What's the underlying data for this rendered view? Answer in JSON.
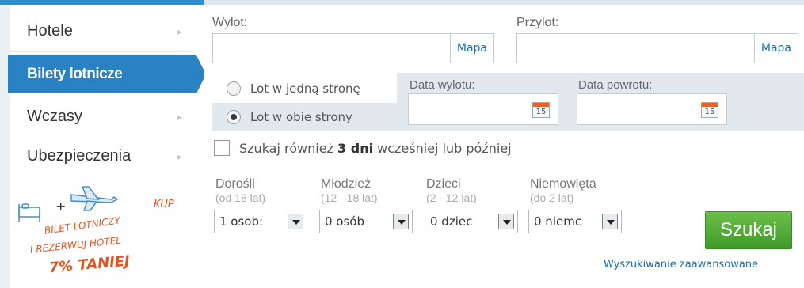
{
  "nav": {
    "items": [
      {
        "label": "Hotele"
      },
      {
        "label": "Bilety lotnicze"
      },
      {
        "label": "Wczasy"
      },
      {
        "label": "Ubezpieczenia"
      }
    ]
  },
  "promo": {
    "line1": "+",
    "line2": "KUP",
    "line3": "BILET LOTNICZY",
    "line4": "I REZERWUJ HOTEL",
    "line5": "7% TANIEJ"
  },
  "form": {
    "departure_label": "Wylot:",
    "arrival_label": "Przylot:",
    "map_label": "Mapa",
    "trip_one_way": "Lot w jedną stronę",
    "trip_round": "Lot w obie strony",
    "selected_trip": "round",
    "departure_date_label": "Data wylotu:",
    "return_date_label": "Data powrotu:",
    "calendar_day": "15",
    "flex_prefix": "Szukaj również ",
    "flex_days": "3 dni",
    "flex_suffix": " wcześniej lub później",
    "passengers": [
      {
        "label": "Dorośli",
        "sub": "(od 18 lat)",
        "value": "1 osob:"
      },
      {
        "label": "Młodzież",
        "sub": "(12 - 18 lat)",
        "value": "0 osób"
      },
      {
        "label": "Dzieci",
        "sub": "(2 - 12 lat)",
        "value": "0 dziec"
      },
      {
        "label": "Niemowlęta",
        "sub": "(do 2 lat)",
        "value": "0 niemc"
      }
    ],
    "search_button": "Szukaj",
    "advanced_link": "Wyszukiwanie zaawansowane"
  },
  "colors": {
    "accent_blue": "#2a82c2",
    "search_green": "#4fa936",
    "promo_red": "#e2551f"
  }
}
